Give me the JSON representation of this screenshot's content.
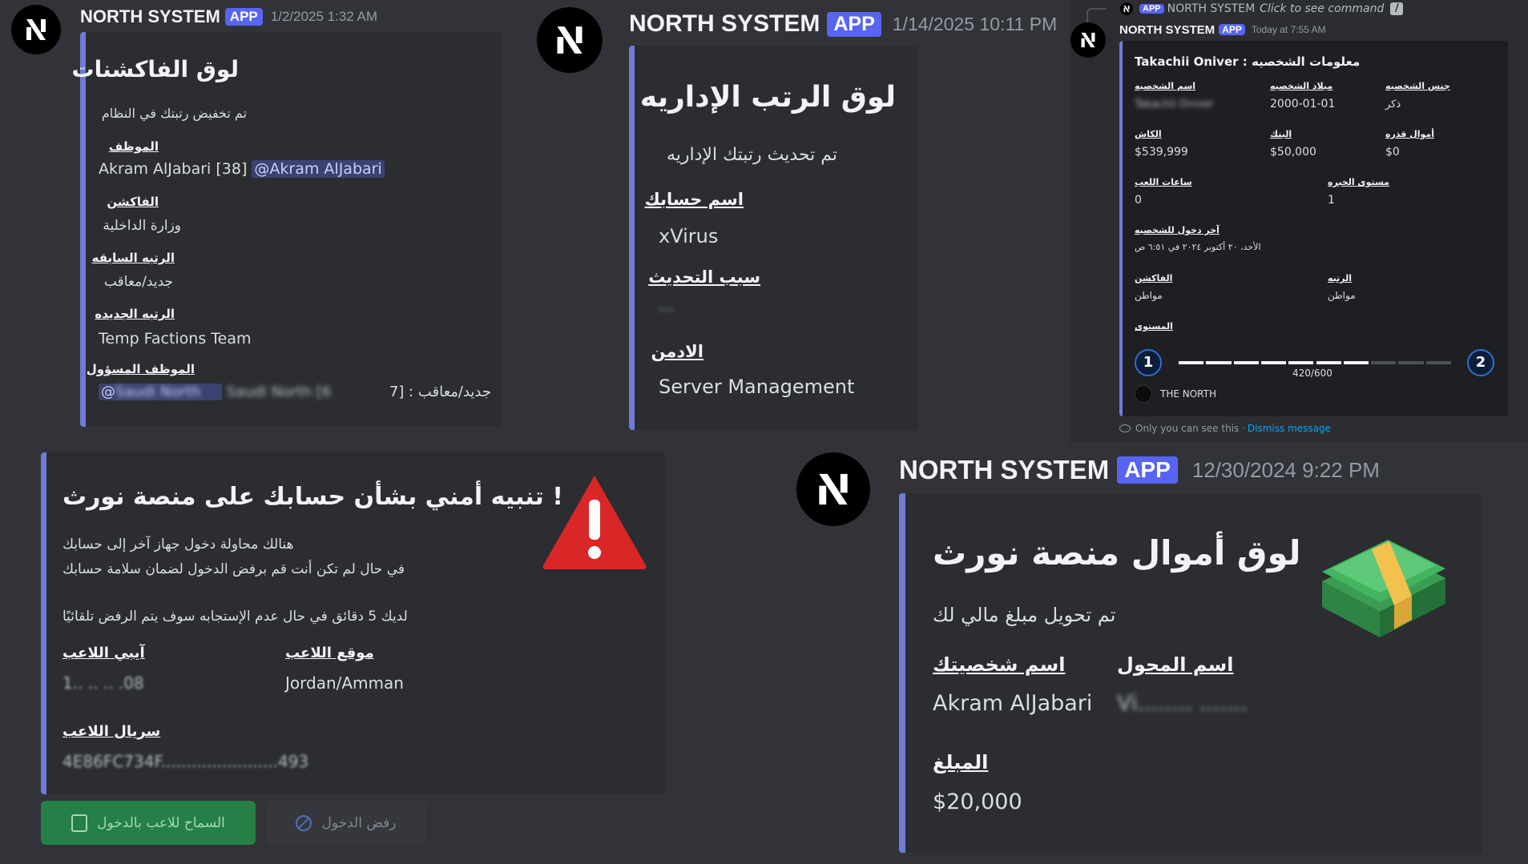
{
  "bot": {
    "name": "NORTH SYSTEM",
    "badge": "APP"
  },
  "colors": {
    "background": "#313338",
    "embed_bg": "#2b2d31",
    "embed_accent": "#6f7bd6",
    "badge": "#5865f2",
    "mention_bg": "#3c4270",
    "allow_button": "#248046",
    "alert_red": "#d92727",
    "link": "#00a8fc"
  },
  "card1": {
    "timestamp": "1/2/2025 1:32 AM",
    "title": "لوق الفاكشنات",
    "description": "تم تخفيض رتبتك في النظام",
    "fields": [
      {
        "name": "الموظف",
        "value": "Akram AlJabari [38]",
        "mention": "@Akram AlJabari"
      },
      {
        "name": "الفاكشن",
        "value": "وزارة الداخلية"
      },
      {
        "name": "الرتبه السابقه",
        "value": "جديد/معاقب"
      },
      {
        "name": "الرتبه الجديده",
        "value": "Temp Factions Team"
      },
      {
        "name": "الموظف المسؤول",
        "value": "جديد/معاقب : [7",
        "mention": "@",
        "hidden": "Saudi North [6"
      }
    ]
  },
  "card2": {
    "timestamp": "1/14/2025 10:11 PM",
    "title": "لوق الرتب الإداريه",
    "description": "تم تحديث رتبتك الإداريه",
    "fields": [
      {
        "name": "اسم حسابك",
        "value": "xVirus"
      },
      {
        "name": "سبب التحديث",
        "value": "..."
      },
      {
        "name": "الادمن",
        "value": "Server Management"
      }
    ]
  },
  "card3": {
    "reply": {
      "badge": "APP",
      "name": "NORTH SYSTEM",
      "hint": "Click to see command"
    },
    "timestamp": "Today at 7:55 AM",
    "title": "Takachii Oniver : معلومات الشخصيه",
    "row1": [
      {
        "name": "اسم الشخصيه",
        "value": "Takachii Oniver"
      },
      {
        "name": "ميلاد الشخصيه",
        "value": "2000-01-01"
      },
      {
        "name": "جنس الشخصيه",
        "value": "ذكر"
      }
    ],
    "row2": [
      {
        "name": "الكاش",
        "value": "$539,999"
      },
      {
        "name": "البنك",
        "value": "$50,000"
      },
      {
        "name": "أموال قذره",
        "value": "$0"
      }
    ],
    "row3": [
      {
        "name": "ساعات اللعب",
        "value": "0"
      },
      {
        "name": "مستوى الخبره",
        "value": "1"
      }
    ],
    "last_login": {
      "name": "آخر دخول للشخصيه",
      "value": "الأحد، ٢٠ أكتوبر ٢٠٢٤ في ٦:٥١ ص"
    },
    "row4": [
      {
        "name": "الفاكشن",
        "value": "مواطن"
      },
      {
        "name": "الرتبه",
        "value": "مواطن"
      }
    ],
    "level": {
      "name": "المستوى",
      "current": "1",
      "next": "2",
      "progress_text": "420/600",
      "progress": 0.7,
      "segments": 10
    },
    "footer": "THE NORTH",
    "ephemeral": {
      "text": "Only you can see this · ",
      "link": "Dismiss message"
    }
  },
  "card4": {
    "title": "! تنبيه أمني بشأن حسابك على منصة نورث",
    "line1": "هنالك محاولة دخول جهاز آخر إلى حسابك",
    "line2": "في حال لم تكن أنت قم برفض الدخول لضمان سلامة حسابك",
    "line3": "لديك 5 دقائق في حال عدم الإستجابه سوف يتم الرفض تلقائيًا",
    "fields": [
      {
        "name": "موقع اللاعب",
        "value": "Jordan/Amman"
      },
      {
        "name": "آيبي اللاعب",
        "value": "1.. .. .. .08"
      },
      {
        "name": "سريال اللاعب",
        "value": "4E86FC734F.......................493"
      }
    ],
    "buttons": {
      "allow": "السماح للاعب بالدخول",
      "deny": "رفض الدخول"
    }
  },
  "card5": {
    "timestamp": "12/30/2024 9:22 PM",
    "title": "لوق أموال منصة نورث",
    "description": "تم تحويل مبلغ مالي لك",
    "fields": [
      {
        "name": "اسم المحول",
        "value": "Vi........ ......."
      },
      {
        "name": "اسم شخصيتك",
        "value": "Akram AlJabari"
      },
      {
        "name": "المبلغ",
        "value": "$20,000"
      }
    ]
  }
}
